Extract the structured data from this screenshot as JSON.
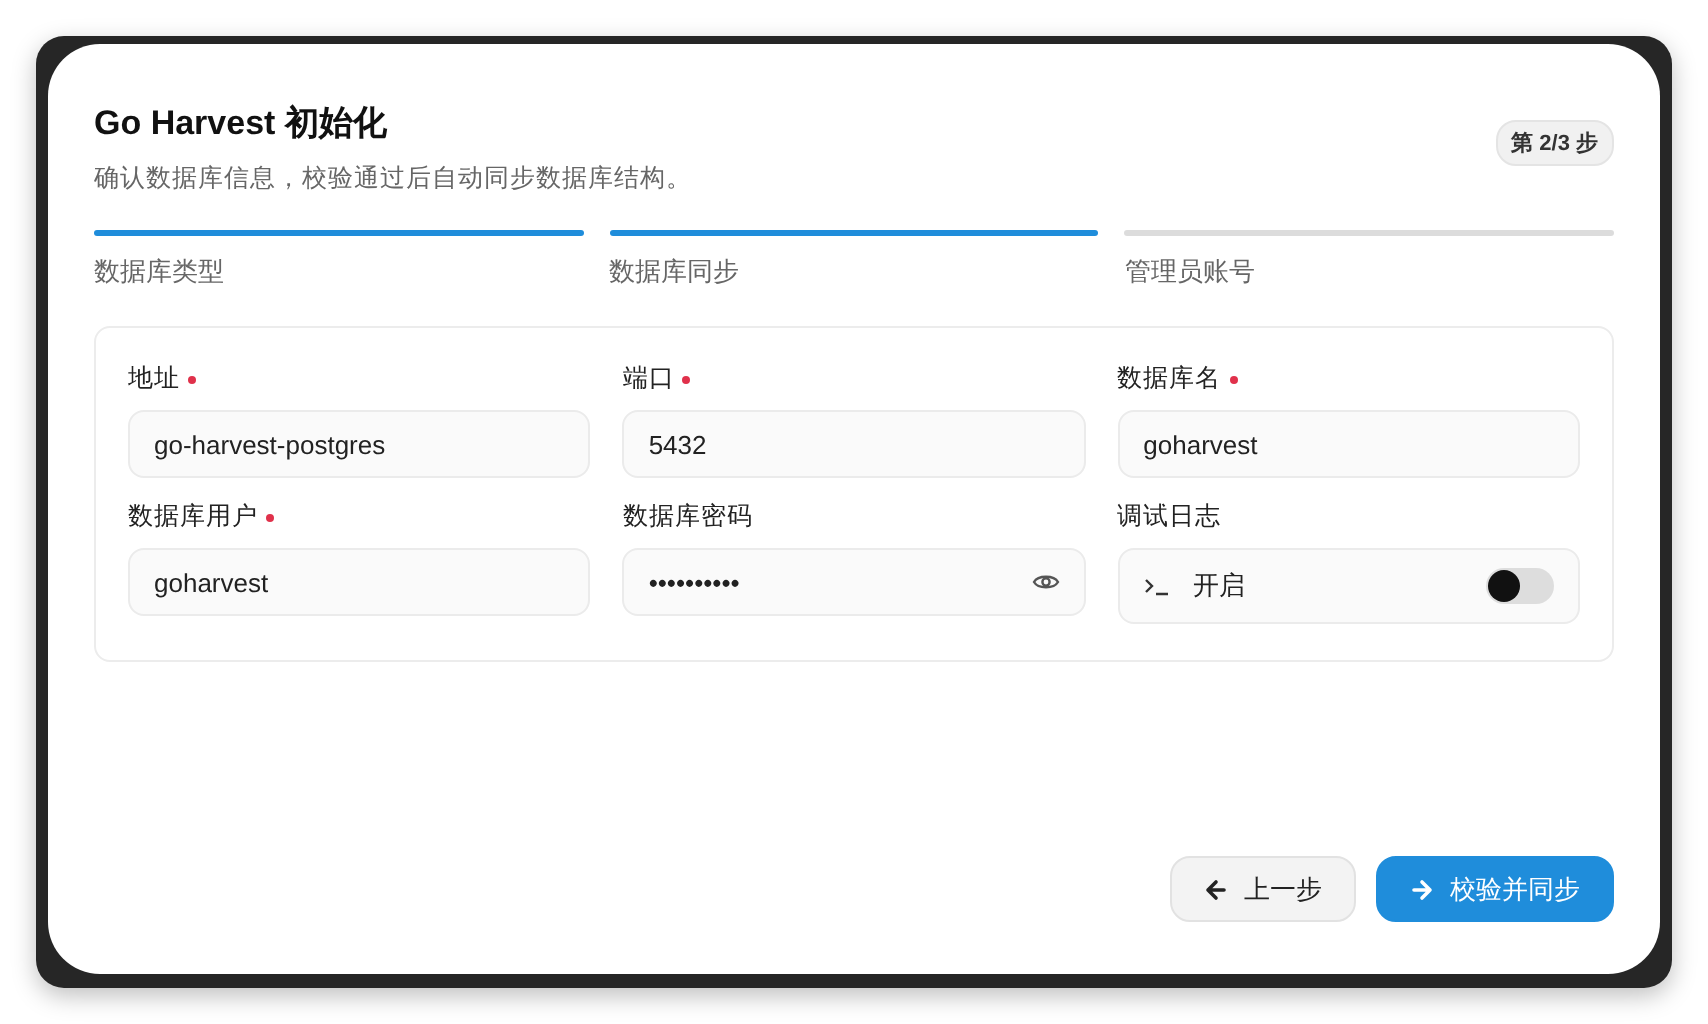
{
  "title": "Go Harvest 初始化",
  "subtitle": "确认数据库信息，校验通过后自动同步数据库结构。",
  "step_badge": "第 2/3 步",
  "steps": [
    {
      "label": "数据库类型",
      "done": true
    },
    {
      "label": "数据库同步",
      "done": true
    },
    {
      "label": "管理员账号",
      "done": false
    }
  ],
  "fields": [
    {
      "kind": "text",
      "label": "地址",
      "required": true,
      "value": "go-harvest-postgres"
    },
    {
      "kind": "text",
      "label": "端口",
      "required": true,
      "value": "5432"
    },
    {
      "kind": "text",
      "label": "数据库名",
      "required": true,
      "value": "goharvest"
    },
    {
      "kind": "text",
      "label": "数据库用户",
      "required": true,
      "value": "goharvest"
    },
    {
      "kind": "password",
      "label": "数据库密码",
      "required": false,
      "value": "••••••••••"
    },
    {
      "kind": "toggle",
      "label": "调试日志",
      "required": false,
      "text": "开启",
      "on": false
    }
  ],
  "buttons": [
    {
      "label": "上一步",
      "kind": "back"
    },
    {
      "label": "校验并同步",
      "kind": "primary"
    }
  ]
}
